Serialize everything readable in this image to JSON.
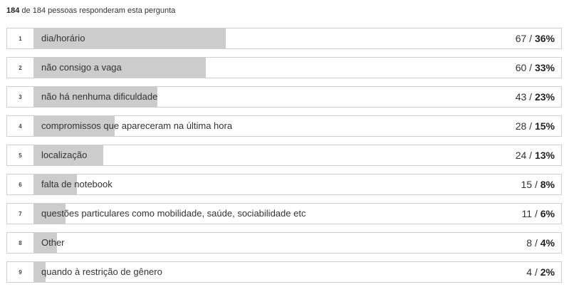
{
  "summary": {
    "responded": "184",
    "text": "de 184 pessoas responderam esta pergunta"
  },
  "colors": {
    "bar": "#cccccc",
    "border": "#cfcfcf"
  },
  "chart_data": {
    "type": "bar",
    "orientation": "horizontal",
    "total": 184,
    "categories": [
      "dia/horário",
      "não consigo a vaga",
      "não há nenhuma dificuldade",
      "compromissos que apareceram na última hora",
      "localização",
      "falta de notebook",
      "questões particulares como mobilidade, saúde, sociabilidade etc",
      "Other",
      "quando à restrição de gênero"
    ],
    "ranks": [
      "1",
      "2",
      "3",
      "4",
      "5",
      "6",
      "7",
      "8",
      "9"
    ],
    "values": [
      67,
      60,
      43,
      28,
      24,
      15,
      11,
      8,
      4
    ],
    "percent_labels": [
      "36%",
      "33%",
      "23%",
      "15%",
      "13%",
      "8%",
      "6%",
      "4%",
      "2%"
    ],
    "xlim": [
      0,
      184
    ]
  }
}
